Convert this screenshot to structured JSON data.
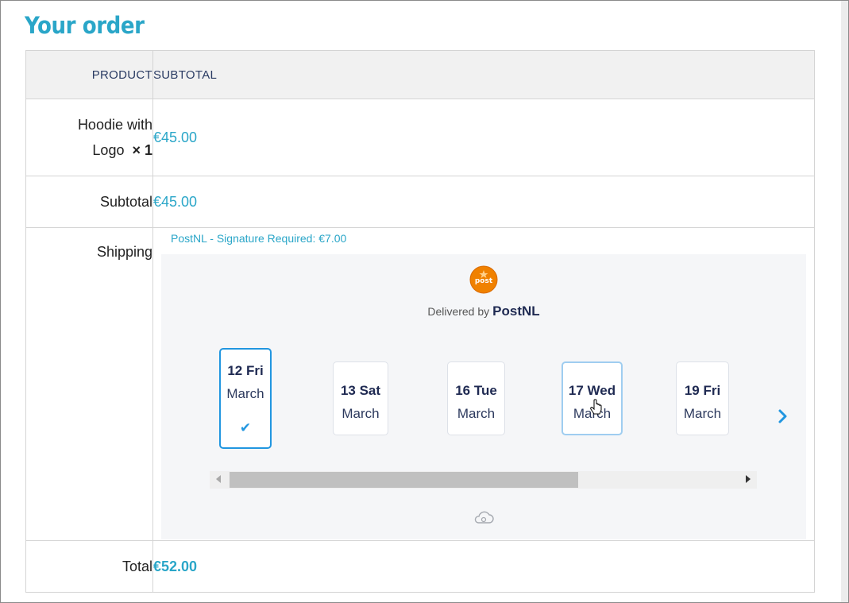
{
  "heading": "Your order",
  "table": {
    "col_product": "PRODUCT",
    "col_subtotal": "SUBTOTAL",
    "item": {
      "name": "Hoodie with Logo",
      "qty": "× 1",
      "price": "€45.00"
    },
    "subtotal": {
      "label": "Subtotal",
      "value": "€45.00"
    },
    "shipping": {
      "label": "Shipping",
      "method": "PostNL - Signature Required: €7.00"
    },
    "total": {
      "label": "Total",
      "value": "€52.00"
    }
  },
  "delivery": {
    "delivered_by": "Delivered by",
    "carrier": "PostNL",
    "days": [
      {
        "day": "12 Fri",
        "month": "March",
        "selected": true
      },
      {
        "day": "13 Sat",
        "month": "March",
        "selected": false
      },
      {
        "day": "16 Tue",
        "month": "March",
        "selected": false
      },
      {
        "day": "17 Wed",
        "month": "March",
        "selected": false
      },
      {
        "day": "19 Fri",
        "month": "March",
        "selected": false
      }
    ],
    "check_icon": "check-icon",
    "next_icon": "chevron-right-icon",
    "footer_icon": "cloud-icon"
  },
  "colors": {
    "accent": "#2aa6c8",
    "selected": "#2196e0",
    "postnl_orange": "#f08100"
  }
}
